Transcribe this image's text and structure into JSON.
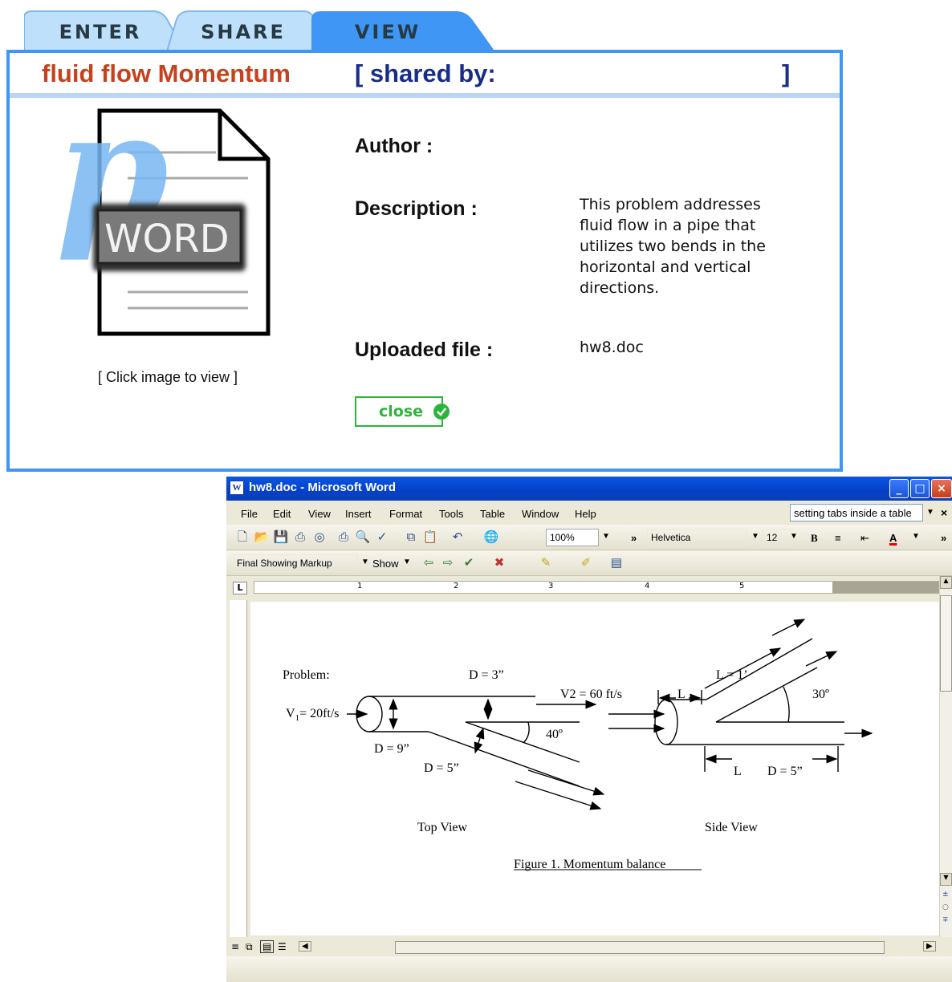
{
  "tabs": [
    {
      "label": "ENTER",
      "active": false
    },
    {
      "label": "SHARE",
      "active": false
    },
    {
      "label": "VIEW",
      "active": true
    }
  ],
  "panel": {
    "title": "fluid flow Momentum",
    "shared_prefix": "[ shared by:",
    "shared_suffix": "]",
    "icon_label": "WORD",
    "icon_letter": "p",
    "click_hint": "[ Click image to view ]",
    "author_label": "Author :",
    "author_value": "",
    "description_label": "Description :",
    "description_value": "This problem addresses fluid flow in a pipe that utilizes two bends in the horizontal and vertical directions.",
    "file_label": "Uploaded file  :",
    "file_value": "hw8.doc",
    "close_label": "close"
  },
  "word": {
    "title": "hw8.doc - Microsoft Word",
    "app_icon_letter": "W",
    "menu": [
      "File",
      "Edit",
      "View",
      "Insert",
      "Format",
      "Tools",
      "Table",
      "Window",
      "Help"
    ],
    "help_search": "setting tabs inside a table",
    "zoom": "100%",
    "font": "Helvetica",
    "font_size": "12",
    "markup_mode": "Final Showing Markup",
    "show_label": "Show",
    "ruler_numbers": [
      "1",
      "2",
      "3",
      "4",
      "5"
    ],
    "figure": {
      "problem": "Problem:",
      "d3": "D = 3”",
      "v2": "V2 = 60 ft/s",
      "v1": "V",
      "v1_sub": "1",
      "v1_rest": "= 20ft/s",
      "angle40": "40º",
      "d9": "D = 9”",
      "d5": "D = 5”",
      "top_view": "Top View",
      "l1": "L = 1’",
      "l": "L",
      "angle30": "30º",
      "l_bottom": "L",
      "d5_side": "D = 5”",
      "side_view": "Side View",
      "caption": "Figure 1. Momentum balance"
    }
  }
}
